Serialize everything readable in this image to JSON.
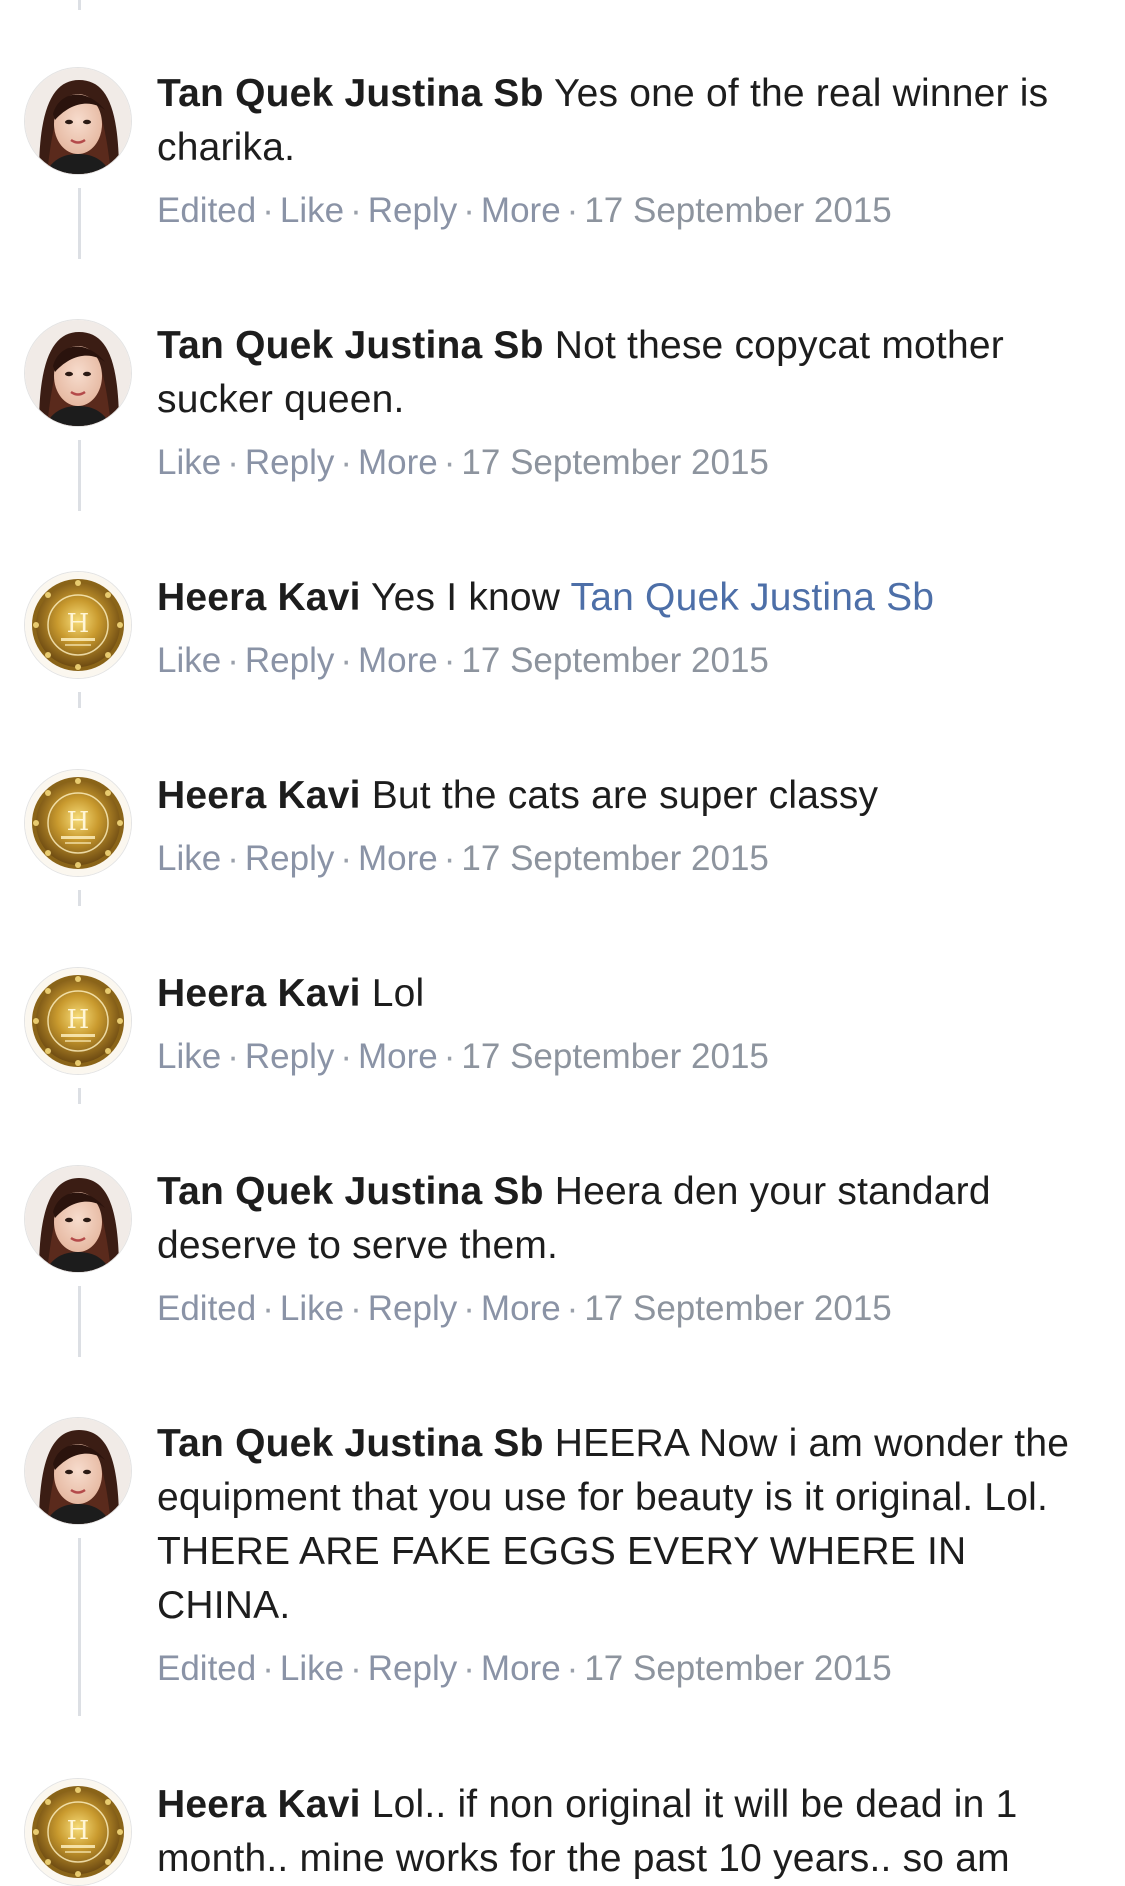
{
  "colors": {
    "author": "#1d1d1d",
    "mention": "#4d6fa8",
    "meta": "#8d949e",
    "thread_line": "#dcdfe4"
  },
  "avatars": {
    "tan": "woman-portrait-avatar",
    "heera": "heeras-gold-logo-avatar"
  },
  "comments": [
    {
      "author": "Tan Quek Justina Sb",
      "text": "Yes one of the real winner is charika.",
      "edited": "Edited",
      "like": "Like",
      "reply": "Reply",
      "more": "More",
      "date": "17 September 2015"
    },
    {
      "author": "Tan Quek Justina Sb",
      "text": "Not these copycat mother sucker queen.",
      "like": "Like",
      "reply": "Reply",
      "more": "More",
      "date": "17 September 2015"
    },
    {
      "author": "Heera Kavi",
      "text": "Yes I know",
      "mention": "Tan Quek Justina Sb",
      "like": "Like",
      "reply": "Reply",
      "more": "More",
      "date": "17 September 2015"
    },
    {
      "author": "Heera Kavi",
      "text": "But the cats are super classy",
      "like": "Like",
      "reply": "Reply",
      "more": "More",
      "date": "17 September 2015"
    },
    {
      "author": "Heera Kavi",
      "text": "Lol",
      "like": "Like",
      "reply": "Reply",
      "more": "More",
      "date": "17 September 2015"
    },
    {
      "author": "Tan Quek Justina Sb",
      "text": "Heera den your standard deserve to serve them.",
      "edited": "Edited",
      "like": "Like",
      "reply": "Reply",
      "more": "More",
      "date": "17 September 2015"
    },
    {
      "author": "Tan Quek Justina Sb",
      "text": "HEERA Now i am wonder the equipment that you use for beauty is it original. Lol. THERE ARE FAKE EGGS EVERY WHERE IN CHINA.",
      "edited": "Edited",
      "like": "Like",
      "reply": "Reply",
      "more": "More",
      "date": "17 September 2015"
    },
    {
      "author": "Heera Kavi",
      "text": "Lol.. if non original it will be dead in 1 month.. mine works for the past 10 years.. so am"
    }
  ]
}
